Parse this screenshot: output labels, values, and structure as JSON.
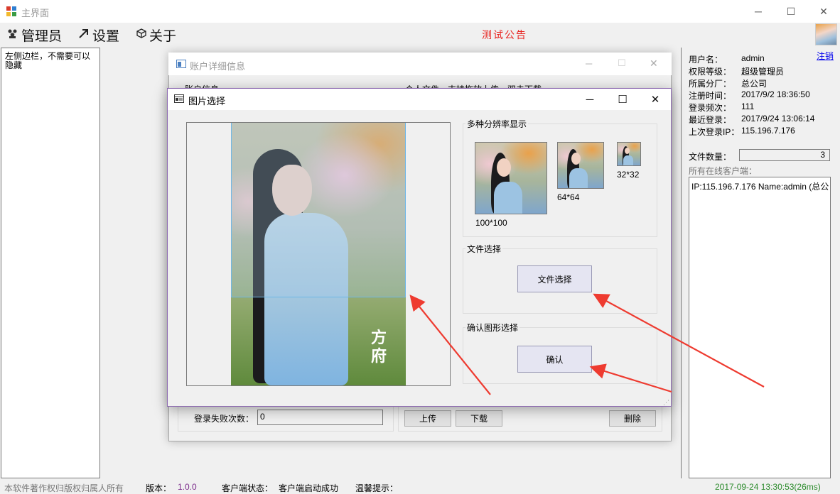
{
  "window": {
    "title": "主界面",
    "minimize": "─",
    "maximize": "☐",
    "close": "✕"
  },
  "menu": [
    {
      "label": "管理员",
      "icon": "users-icon"
    },
    {
      "label": "设置",
      "icon": "arrow-icon"
    },
    {
      "label": "关于",
      "icon": "cube-icon"
    }
  ],
  "notice": "测试公告",
  "sidebar": {
    "text": "左侧边栏，不需要可以隐藏"
  },
  "user_info": {
    "logout": "注销",
    "rows": [
      {
        "label": "用户名：",
        "value": "admin"
      },
      {
        "label": "权限等级：",
        "value": "超级管理员"
      },
      {
        "label": "所属分厂：",
        "value": "总公司"
      },
      {
        "label": "注册时间：",
        "value": "2017/9/2 18:36:50"
      },
      {
        "label": "登录频次：",
        "value": "111"
      },
      {
        "label": "最近登录：",
        "value": "2017/9/24 13:06:14"
      },
      {
        "label": "上次登录IP：",
        "value": "115.196.7.176"
      }
    ],
    "file_count_label": "文件数量：",
    "file_count": "3",
    "online_label": "所有在线客户端：",
    "online_clients": [
      "IP:115.196.7.176 Name:admin (总公"
    ]
  },
  "status_bar": {
    "copyright": "本软件著作权归版权归属人所有",
    "version_label": "版本：",
    "version": "1.0.0",
    "client_status_label": "客户端状态：",
    "client_status": "客户端启动成功",
    "tip_label": "温馨提示：",
    "datetime": "2017-09-24 13:30:53(26ms)"
  },
  "account_window": {
    "title": "账户详细信息",
    "account_info_label": "账户信息",
    "file_hint": "个人文件，支持拖放上传，双击下载",
    "fail_count_label": "登录失败次数：",
    "fail_count": "0",
    "upload": "上传",
    "download": "下载",
    "delete": "删除"
  },
  "picture_dialog": {
    "title": "图片选择",
    "multi_res_label": "多种分辨率显示",
    "sizes": [
      "100*100",
      "64*64",
      "32*32"
    ],
    "file_select_group": "文件选择",
    "file_select_button": "文件选择",
    "confirm_group": "确认图形选择",
    "confirm_button": "确认",
    "seal_text": "方\n府"
  },
  "colors": {
    "notice": "#e8201c",
    "arrow": "#ee3b30",
    "version": "#7a2a8a",
    "datetime": "#2a8a2a"
  }
}
